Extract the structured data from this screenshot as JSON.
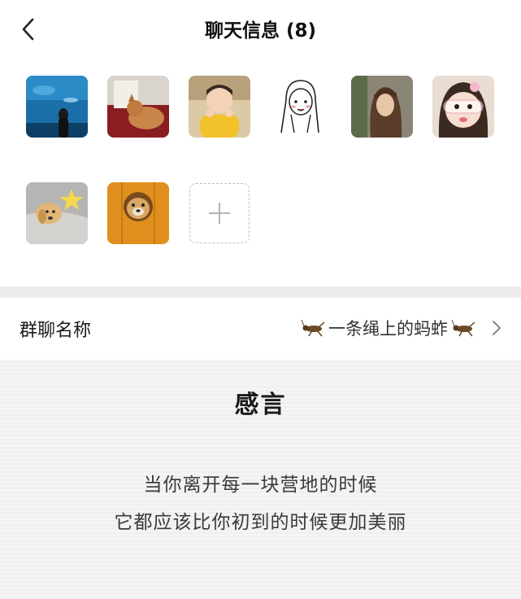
{
  "nav": {
    "back_icon": "chevron-left-icon",
    "title": "聊天信息 (8)"
  },
  "members": [
    {
      "avatar": "aquarium-photo"
    },
    {
      "avatar": "cat-on-bed-photo"
    },
    {
      "avatar": "toddler-yellow-shirt-photo"
    },
    {
      "avatar": "cartoon-girl-drawing"
    },
    {
      "avatar": "woman-portrait-photo"
    },
    {
      "avatar": "girl-with-glasses-photo"
    },
    {
      "avatar": "golden-puppy-with-star-photo"
    },
    {
      "avatar": "dog-in-wood-hole-photo"
    }
  ],
  "add_member": {
    "icon": "plus-icon"
  },
  "group_name": {
    "label": "群聊名称",
    "value": "一条绳上的蚂蚱",
    "decor_icon": "grasshopper-icon",
    "chevron": "chevron-right-icon"
  },
  "note": {
    "title": "感言",
    "lines": [
      "当你离开每一块营地的时候",
      "它都应该比你初到的时候更加美丽"
    ]
  },
  "colors": {
    "background": "#f2f2f2",
    "panel": "#ffffff",
    "text": "#1a1a1a"
  }
}
